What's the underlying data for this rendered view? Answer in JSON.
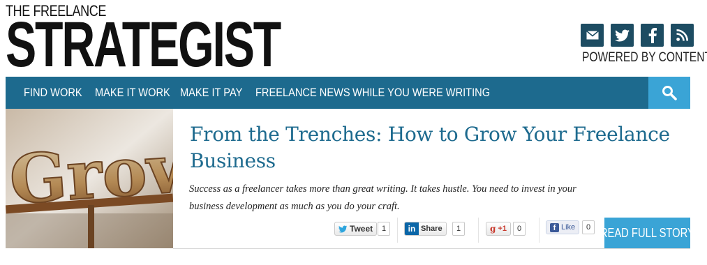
{
  "masthead": {
    "logo_top": "THE FREELANCE",
    "logo_main": "STRATEGIST",
    "powered_by": "POWERED BY CONTENTLY",
    "social_icons": [
      "mail-icon",
      "twitter-icon",
      "facebook-icon",
      "rss-icon"
    ]
  },
  "nav": {
    "items": [
      "FIND WORK",
      "MAKE IT WORK",
      "MAKE IT PAY",
      "FREELANCE NEWS",
      "WHILE YOU WERE WRITING"
    ],
    "search_icon": "search-icon"
  },
  "feature": {
    "image_text": "Grow",
    "headline": "From the Trenches: How to Grow Your Freelance Business",
    "excerpt": "Success as a freelancer takes more than great writing. It takes hustle. You need to invest in your business development as much as you do your craft.",
    "read_more": "READ FULL STORY"
  },
  "share": {
    "tweet_label": "Tweet",
    "tweet_count": "1",
    "linkedin_label": "Share",
    "linkedin_count": "1",
    "gplus_label": "+1",
    "gplus_count": "0",
    "facebook_label": "Like",
    "facebook_count": "0"
  },
  "colors": {
    "nav_bg": "#1d6a8e",
    "accent": "#3aa4d6",
    "social_bg": "#1d4c62",
    "headline": "#1d6a8e"
  }
}
